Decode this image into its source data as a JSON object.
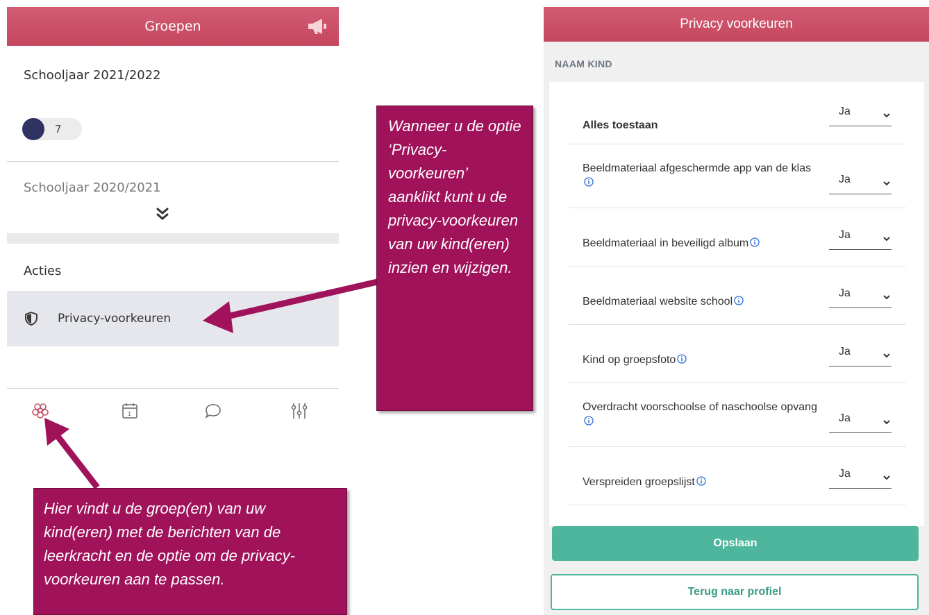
{
  "left": {
    "header_title": "Groepen",
    "school_year_current": "Schooljaar 2021/2022",
    "group_count": "7",
    "school_year_previous": "Schooljaar 2020/2021",
    "actions_label": "Acties",
    "privacy_item_label": "Privacy-voorkeuren",
    "nav": [
      "groups-icon",
      "calendar-icon",
      "chat-icon",
      "settings-icon"
    ],
    "accent_color": "#c9506a",
    "group_dot_color": "#2f3364"
  },
  "callouts": {
    "right_text": "Wanneer u de optie ‘Privacy-voorkeuren’ aanklikt kunt u de privacy-voorkeuren van uw kind(eren) inzien en wijzigen.",
    "bottom_text": "Hier vindt u de groep(en) van uw kind(eren) met de berichten van de leerkracht en de optie om de privacy-voorkeuren aan te passen.",
    "color": "#a0125a"
  },
  "right": {
    "header_title": "Privacy voorkeuren",
    "child_label": "NAAM KIND",
    "preferences": [
      {
        "label": "Alles toestaan",
        "value": "Ja"
      },
      {
        "label": "Beeldmateriaal afgeschermde app van de klas",
        "value": "Ja"
      },
      {
        "label": "Beeldmateriaal in beveiligd album",
        "value": "Ja"
      },
      {
        "label": "Beeldmateriaal website school",
        "value": "Ja"
      },
      {
        "label": "Kind op groepsfoto",
        "value": "Ja"
      },
      {
        "label": "Overdracht voorschoolse of naschoolse opvang",
        "value": "Ja"
      },
      {
        "label": "Verspreiden groepslijst",
        "value": "Ja"
      }
    ],
    "save_label": "Opslaan",
    "back_label": "Terug naar profiel",
    "button_color": "#4db69c"
  }
}
